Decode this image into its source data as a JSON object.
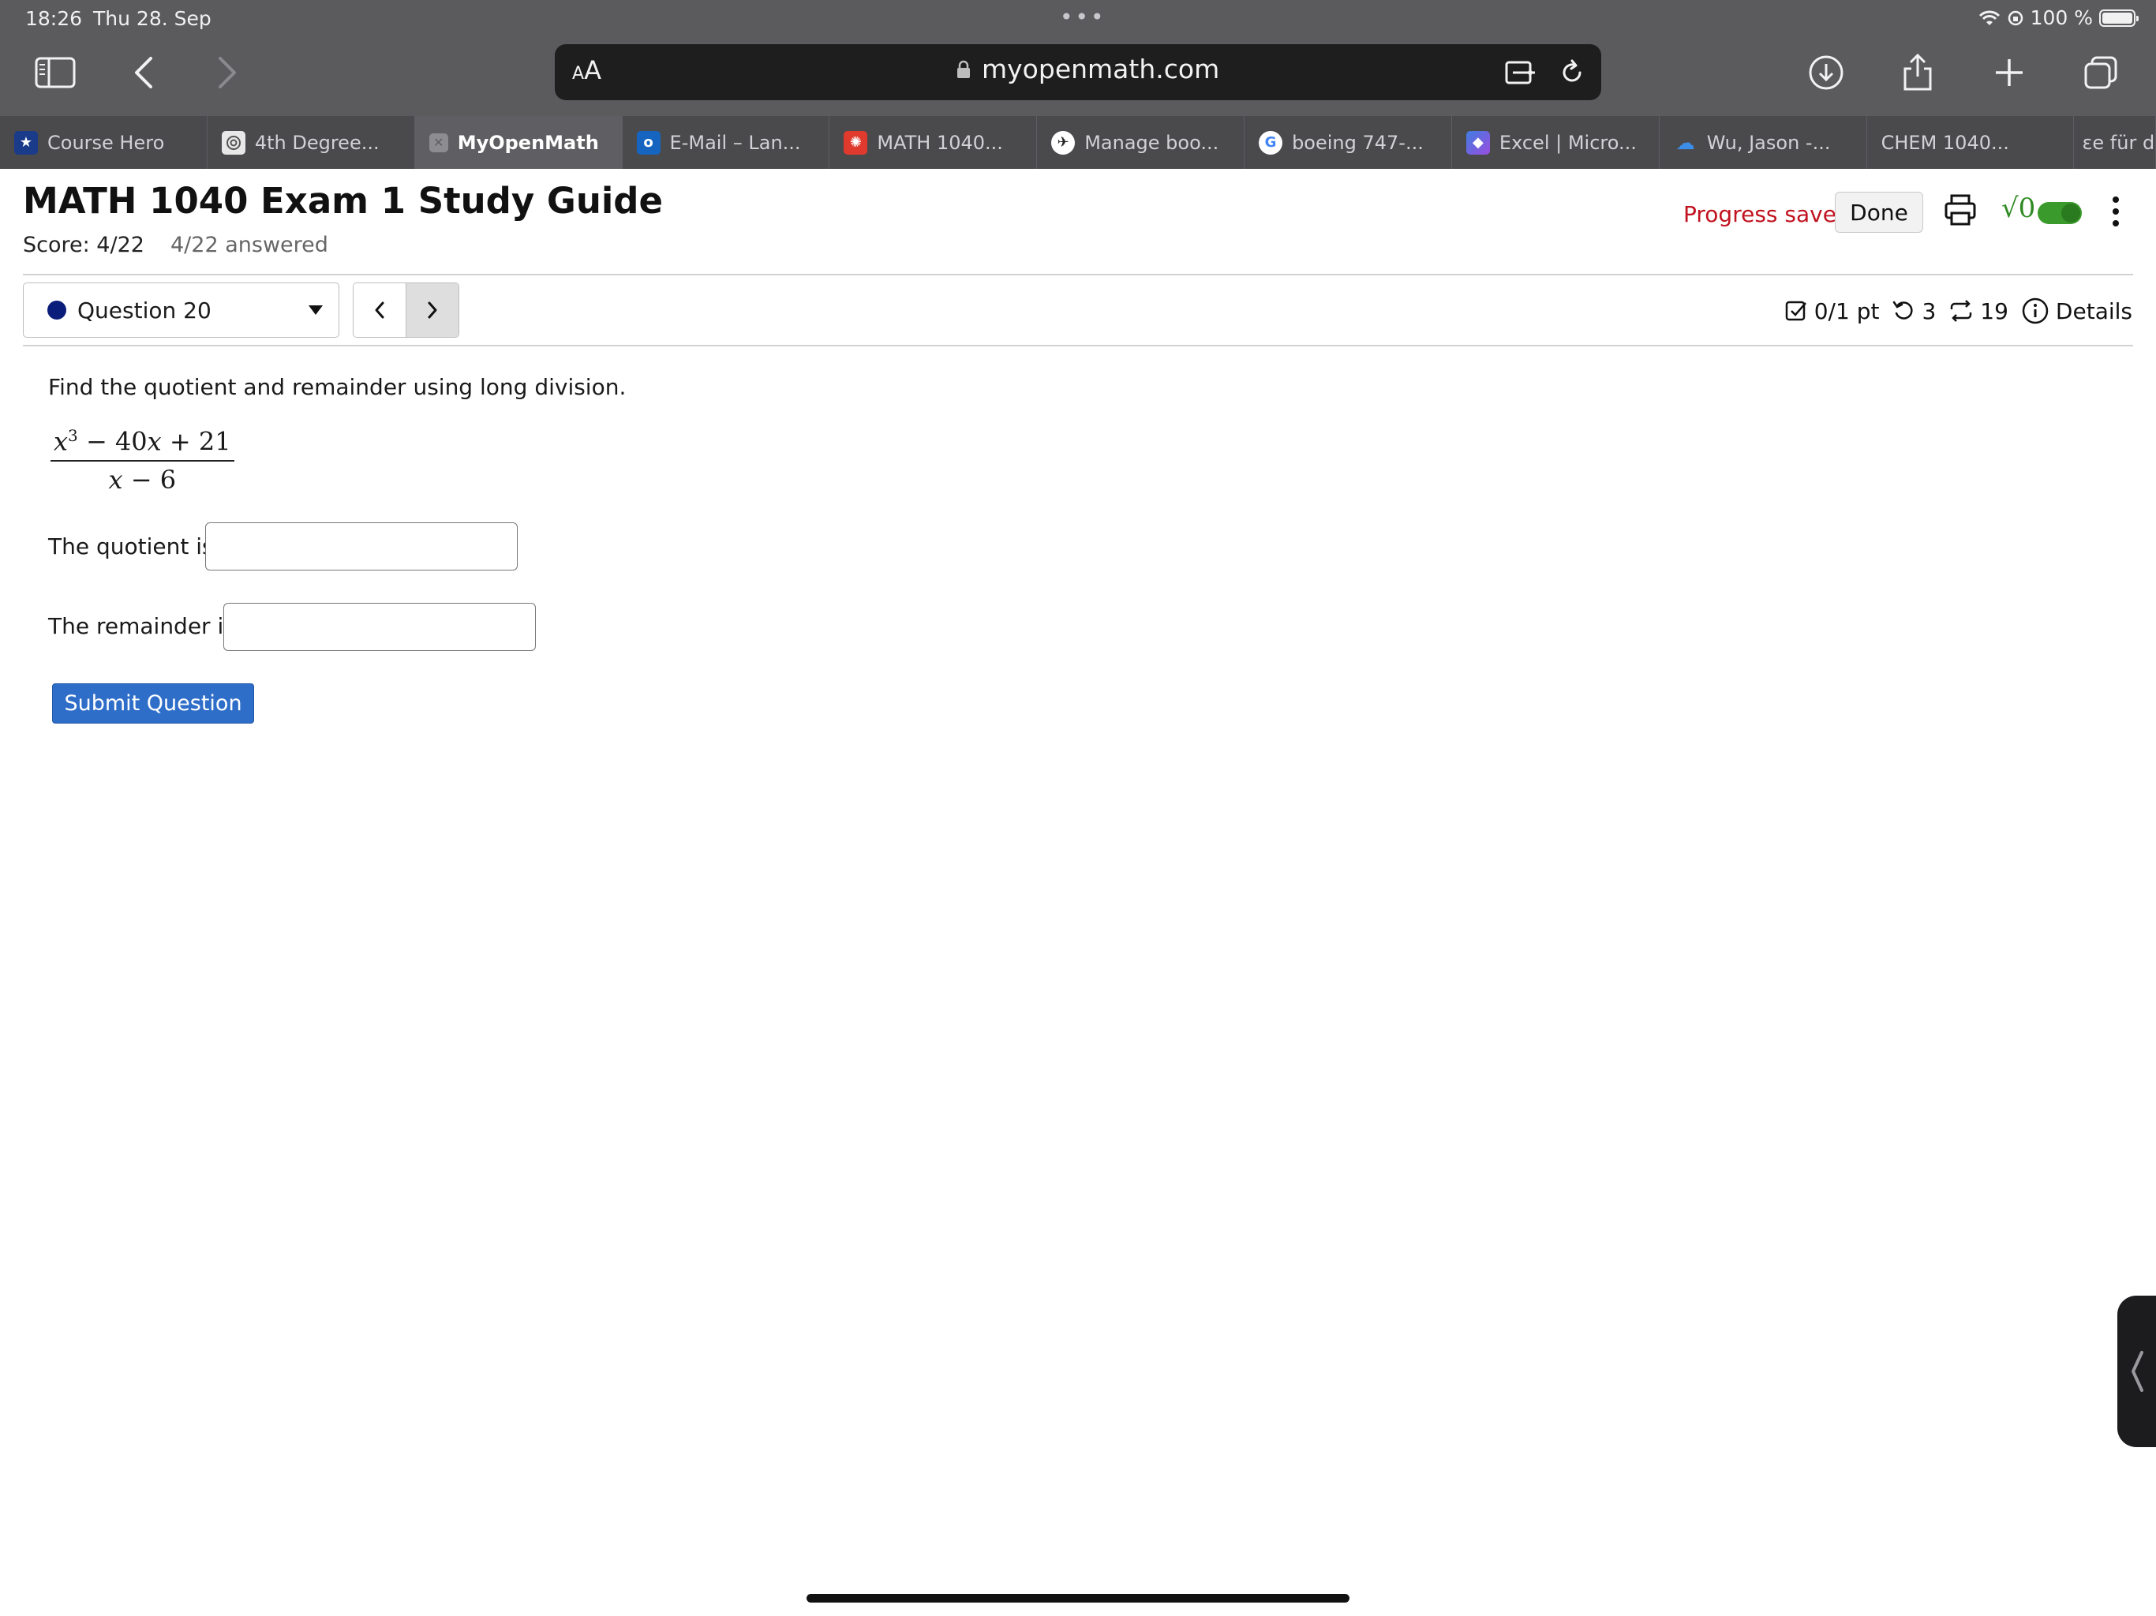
{
  "status_bar": {
    "time": "18:26",
    "date": "Thu 28. Sep",
    "battery": "100 %",
    "dots": "•••"
  },
  "browser": {
    "reader_small": "A",
    "reader_large": "A",
    "url": "myopenmath.com",
    "tabs": [
      {
        "label": "Course Hero",
        "icon": "course-hero-icon"
      },
      {
        "label": "4th Degree...",
        "icon": "chatgpt-icon"
      },
      {
        "label": "MyOpenMath",
        "icon": "close-icon",
        "active": true
      },
      {
        "label": "E-Mail – Lan...",
        "icon": "outlook-icon"
      },
      {
        "label": "MATH 1040...",
        "icon": "canvas-icon"
      },
      {
        "label": "Manage boo...",
        "icon": "airline-icon"
      },
      {
        "label": "boeing 747-...",
        "icon": "google-icon"
      },
      {
        "label": "Excel | Micro...",
        "icon": "copilot-icon"
      },
      {
        "label": "Wu, Jason -...",
        "icon": "onedrive-icon"
      },
      {
        "label": "CHEM 1040...",
        "icon": ""
      },
      {
        "label": "ɛe für de...",
        "icon": ""
      }
    ]
  },
  "assessment": {
    "title": "MATH 1040 Exam 1 Study Guide",
    "score": "Score: 4/22",
    "answered": "4/22 answered",
    "progress_saved": "Progress saved",
    "done_label": "Done",
    "sqrt_label": "√0"
  },
  "question_nav": {
    "selected": "Question 20"
  },
  "question_meta": {
    "points": "0/1 pt",
    "retries": "3",
    "attempts": "19",
    "details": "Details"
  },
  "question": {
    "prompt": "Find the quotient and remainder using long division.",
    "numerator_x": "x",
    "numerator_exp": "3",
    "numerator_rest": " − 40",
    "numerator_x2": "x",
    "numerator_end": " + 21",
    "denominator_x": "x",
    "denominator_rest": " − 6",
    "quotient_label": "The quotient is",
    "quotient_value": "",
    "remainder_label": "The remainder is",
    "remainder_value": "",
    "submit_label": "Submit Question"
  },
  "colors": {
    "accent_blue": "#2e6ec9",
    "progress_red": "#c1121f",
    "toggle_green": "#3a9a2b"
  }
}
